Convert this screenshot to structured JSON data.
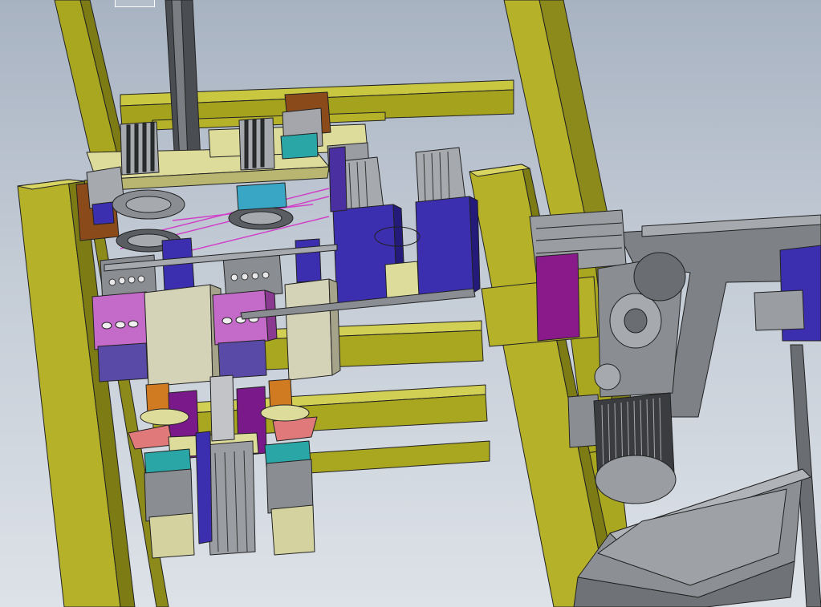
{
  "viewport": {
    "background_top": "#a8b3c2",
    "background_bottom": "#dde2e8"
  },
  "colors": {
    "frame_yellow": "#b5b22a",
    "frame_yellow_dark": "#7d7b14",
    "frame_yellow_light": "#d2cf55",
    "plate_cream": "#dedc9a",
    "cylinder_blue": "#3b2fb0",
    "cylinder_blue_dark": "#231a7a",
    "magenta_block": "#c46ac9",
    "purple_part": "#7a1a8a",
    "steel_grey": "#8a8d92",
    "steel_dark": "#4a4d52",
    "teal_part": "#2aa6a6",
    "brown_part": "#8a4a1a",
    "orange_part": "#d07a22",
    "salmon_part": "#e07a7a",
    "motor_grey": "#9a9da2",
    "tray_grey": "#8c8f94"
  },
  "scene_parts": [
    "frame-structure",
    "top-plate",
    "linear-actuator",
    "blue-cylinders",
    "magenta-blocks",
    "gear-motor",
    "conveyor-arm",
    "output-tray",
    "lower-cylinders"
  ]
}
